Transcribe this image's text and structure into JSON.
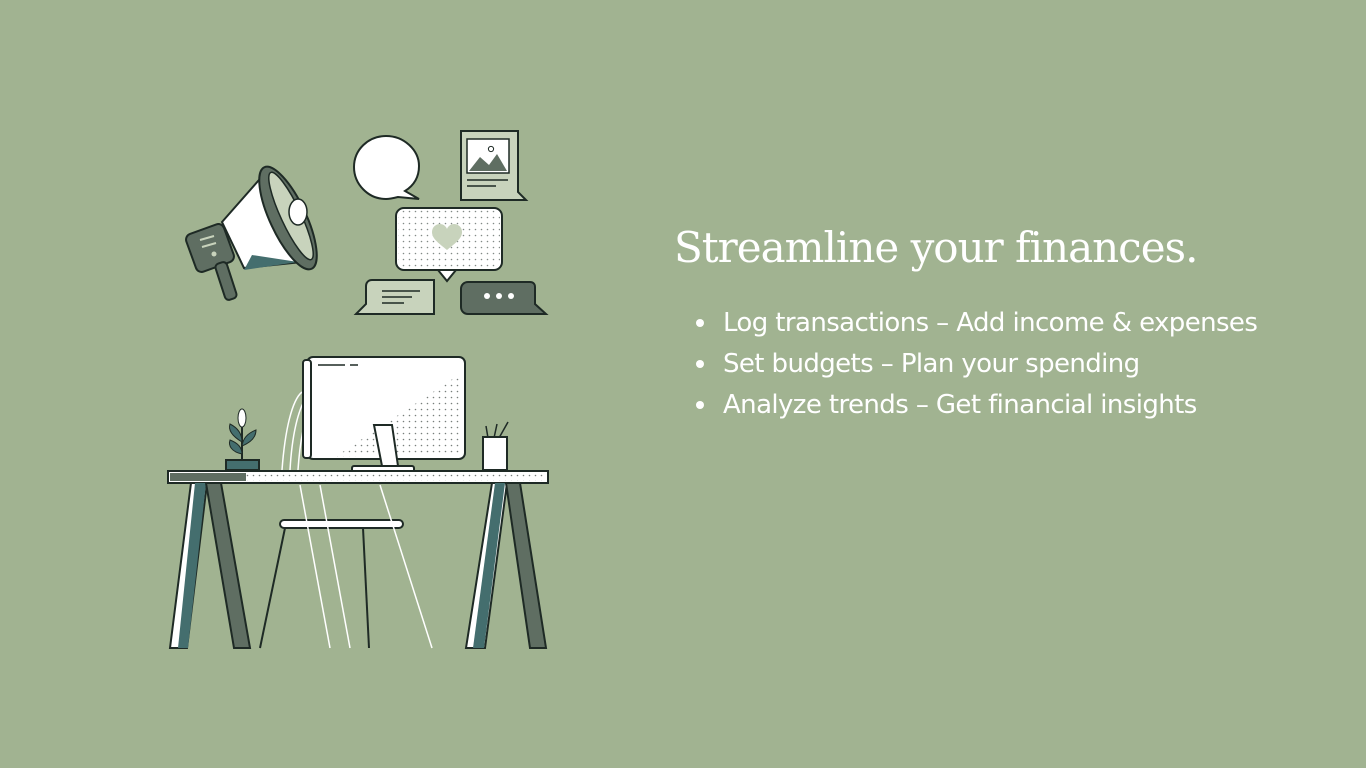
{
  "slide": {
    "headline": "Streamline your finances.",
    "features": [
      "Log transactions – Add income & expenses",
      "Set budgets – Plan your spending",
      "Analyze trends – Get financial insights"
    ]
  },
  "colors": {
    "background": "#a1b391",
    "text": "#ffffff",
    "dark_teal": "#446e6e",
    "dark_gray": "#5f6e62",
    "light_sage": "#c8d3bc",
    "outline": "#1e2a25"
  },
  "illustration": {
    "icons": [
      "megaphone-icon",
      "speech-bubble-icon",
      "image-card-icon",
      "heart-message-icon",
      "text-message-icon",
      "typing-message-icon",
      "desk",
      "monitor",
      "plant",
      "pencil-cup",
      "chair"
    ]
  }
}
